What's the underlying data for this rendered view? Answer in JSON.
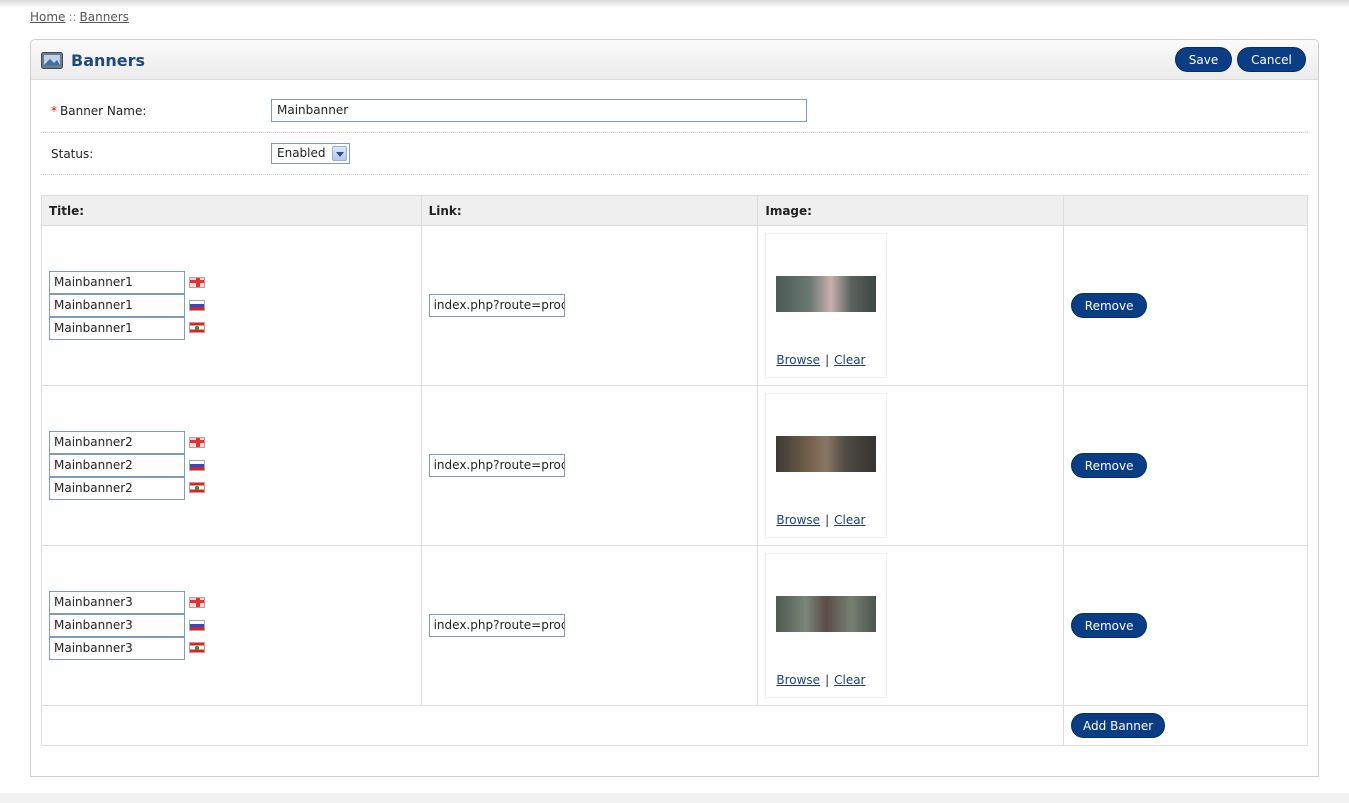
{
  "breadcrumb": {
    "home": "Home",
    "separator": "::",
    "current": "Banners"
  },
  "heading": {
    "title": "Banners",
    "icon": "banner-image-icon"
  },
  "toolbar": {
    "save_label": "Save",
    "cancel_label": "Cancel"
  },
  "form": {
    "required_mark": "*",
    "name_label": "Banner Name:",
    "name_value": "Mainbanner",
    "status_label": "Status:",
    "status_value": "Enabled"
  },
  "table": {
    "headers": {
      "title": "Title:",
      "link": "Link:",
      "image": "Image:",
      "action": ""
    },
    "rows": [
      {
        "titles": [
          "Mainbanner1",
          "Mainbanner1",
          "Mainbanner1"
        ],
        "link": "index.php?route=produ",
        "browse": "Browse",
        "separator": "|",
        "clear": "Clear",
        "remove": "Remove"
      },
      {
        "titles": [
          "Mainbanner2",
          "Mainbanner2",
          "Mainbanner2"
        ],
        "link": "index.php?route=produ",
        "browse": "Browse",
        "separator": "|",
        "clear": "Clear",
        "remove": "Remove"
      },
      {
        "titles": [
          "Mainbanner3",
          "Mainbanner3",
          "Mainbanner3"
        ],
        "link": "index.php?route=produ",
        "browse": "Browse",
        "separator": "|",
        "clear": "Clear",
        "remove": "Remove"
      }
    ],
    "flags": [
      "uk-flag-icon",
      "russia-flag-icon",
      "lebanon-flag-icon"
    ],
    "add_label": "Add Banner"
  },
  "colors": {
    "primary_button": "#0b3d84",
    "heading_text": "#1e4a80",
    "required": "#ee0000"
  }
}
